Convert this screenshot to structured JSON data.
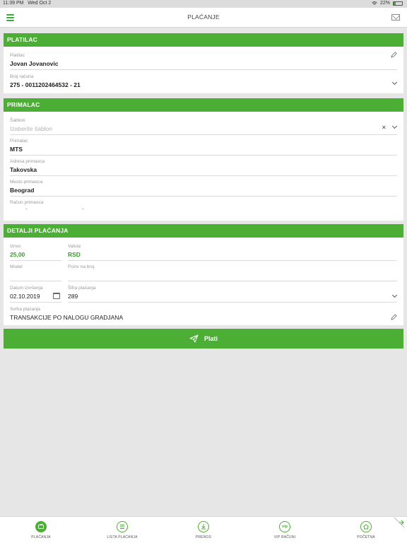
{
  "status": {
    "time": "11:39 PM",
    "date": "Wed Oct 2",
    "battery": "22%"
  },
  "navbar": {
    "title": "PLAĆANJE"
  },
  "payer": {
    "header": "PLATILAC",
    "name_label": "Platilac",
    "name_value": "Jovan Jovanovic",
    "account_label": "Broj računa",
    "account_value": "275 - 0011202464532 - 21"
  },
  "recipient": {
    "header": "PRIMALAC",
    "template_label": "Šabloni",
    "template_placeholder": "Izaberite šablon",
    "name_label": "Primalac",
    "name_value": "MTS",
    "address_label": "Adresa primaoca",
    "address_value": "Takovska",
    "city_label": "Mesto primaoca",
    "city_value": "Beograd",
    "account_label": "Račun primaoca",
    "account_sep1": "-",
    "account_sep2": "-"
  },
  "details": {
    "header": "DETALJI PLAĆANJA",
    "amount_label": "Iznos",
    "amount_value": "25,00",
    "currency_label": "Valuta",
    "currency_value": "RSD",
    "model_label": "Model",
    "reference_label": "Poziv na broj",
    "date_label": "Datum izvršenja",
    "date_value": "02.10.2019",
    "code_label": "Šifra plaćanja",
    "code_value": "289",
    "purpose_label": "Svrha plaćanja",
    "purpose_value": "TRANSAKCIJE PO NALOGU GRADJANA"
  },
  "pay_button": {
    "label": "Plati"
  },
  "tabs": [
    {
      "label": "PLAĆANJA",
      "icon": "wallet-icon"
    },
    {
      "label": "LISTA PLAĆANJA",
      "icon": "list-icon"
    },
    {
      "label": "PRENOS",
      "icon": "download-icon"
    },
    {
      "label": "VIP RAČUNI",
      "icon": "vip-icon"
    },
    {
      "label": "POČETNA",
      "icon": "home-icon"
    }
  ],
  "colors": {
    "accent": "#4cae35",
    "text": "#222222",
    "label": "#999999"
  }
}
